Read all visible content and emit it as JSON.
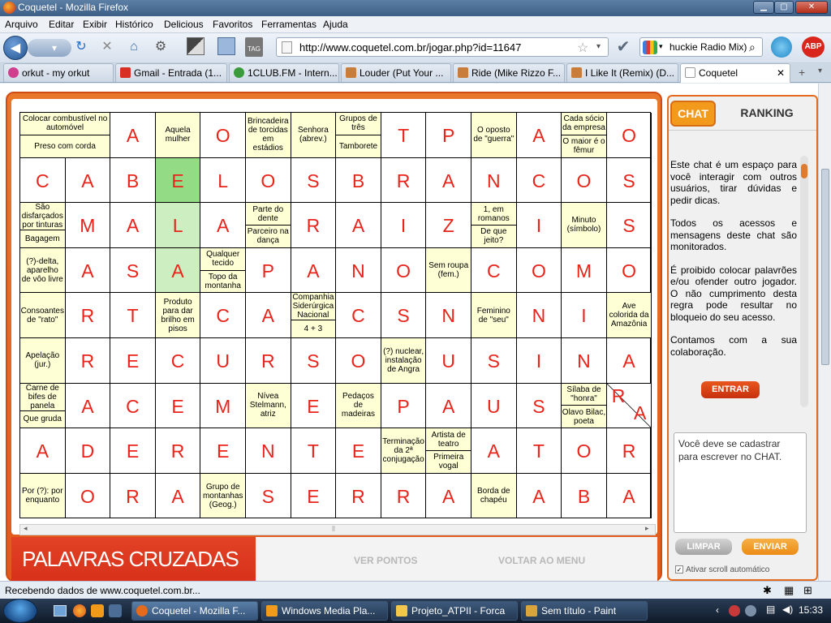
{
  "window": {
    "title": "Coquetel - Mozilla Firefox"
  },
  "menu": [
    "Arquivo",
    "Editar",
    "Exibir",
    "Histórico",
    "Delicious",
    "Favoritos",
    "Ferramentas",
    "Ajuda"
  ],
  "nav": {
    "url": "http://www.coquetel.com.br/jogar.php?id=11647",
    "search_value": "huckie Radio Mix)"
  },
  "tabs": [
    {
      "label": "orkut - my orkut",
      "color": "#d03f8e"
    },
    {
      "label": "Gmail - Entrada (1...",
      "color": "#d93025"
    },
    {
      "label": "1CLUB.FM - Intern...",
      "color": "#3a9b3a"
    },
    {
      "label": "Louder (Put Your ...",
      "color": "#c97d3b"
    },
    {
      "label": "Ride (Mike Rizzo F...",
      "color": "#c97d3b"
    },
    {
      "label": "I Like It (Remix) (D...",
      "color": "#c97d3b"
    },
    {
      "label": "Coquetel",
      "color": "#ffffff"
    }
  ],
  "crossword": {
    "rows": [
      [
        {
          "c": "Colocar combustível no automóvel|Preso com corda",
          "w": 2
        },
        {
          "l": "A"
        },
        {
          "c": "Aquela mulher"
        },
        {
          "l": "O"
        },
        {
          "c": "Brincadeira de torcidas em estádios"
        },
        {
          "c": "Senhora (abrev.)"
        },
        {
          "c": "Grupos de três|Tamborete"
        },
        {
          "l": "T"
        },
        {
          "l": "P"
        },
        {
          "c": "O oposto de \"guerra\""
        },
        {
          "l": "A"
        },
        {
          "c": "Cada sócio da empresa|O maior é o fêmur"
        },
        {
          "l": "O"
        }
      ],
      [
        {
          "l": "C"
        },
        {
          "l": "A"
        },
        {
          "l": "B"
        },
        {
          "l": "E",
          "hl": 2
        },
        {
          "l": "L"
        },
        {
          "l": "O"
        },
        {
          "l": "S"
        },
        {
          "l": "B"
        },
        {
          "l": "R"
        },
        {
          "l": "A"
        },
        {
          "l": "N"
        },
        {
          "l": "C"
        },
        {
          "l": "O"
        },
        {
          "l": "S"
        }
      ],
      [
        {
          "c": "São disfarçados por tinturas|Bagagem"
        },
        {
          "l": "M"
        },
        {
          "l": "A"
        },
        {
          "l": "L",
          "hl": 1
        },
        {
          "l": "A"
        },
        {
          "c": "Parte do dente|Parceiro na dança"
        },
        {
          "l": "R"
        },
        {
          "l": "A"
        },
        {
          "l": "I"
        },
        {
          "l": "Z"
        },
        {
          "c": "1, em romanos|De que jeito?"
        },
        {
          "l": "I"
        },
        {
          "c": "Minuto (símbolo)"
        },
        {
          "l": "S"
        }
      ],
      [
        {
          "c": "(?)-delta, aparelho de vôo livre"
        },
        {
          "l": "A"
        },
        {
          "l": "S"
        },
        {
          "l": "A",
          "hl": 1
        },
        {
          "c": "Qualquer tecido|Topo da montanha"
        },
        {
          "l": "P"
        },
        {
          "l": "A"
        },
        {
          "l": "N"
        },
        {
          "l": "O"
        },
        {
          "c": "Sem roupa (fem.)"
        },
        {
          "l": "C"
        },
        {
          "l": "O"
        },
        {
          "l": "M"
        },
        {
          "l": "O"
        }
      ],
      [
        {
          "c": "Consoantes de \"rato\""
        },
        {
          "l": "R"
        },
        {
          "l": "T"
        },
        {
          "c": "Produto para dar brilho em pisos"
        },
        {
          "l": "C"
        },
        {
          "l": "A"
        },
        {
          "c": "Companhia Siderúrgica Nacional|4 + 3"
        },
        {
          "l": "C"
        },
        {
          "l": "S"
        },
        {
          "l": "N"
        },
        {
          "c": "Feminino de \"seu\""
        },
        {
          "l": "N"
        },
        {
          "l": "I"
        },
        {
          "c": "Ave colorida da Amazônia"
        }
      ],
      [
        {
          "c": "Apelação (jur.)"
        },
        {
          "l": "R"
        },
        {
          "l": "E"
        },
        {
          "l": "C"
        },
        {
          "l": "U"
        },
        {
          "l": "R"
        },
        {
          "l": "S"
        },
        {
          "l": "O"
        },
        {
          "c": "(?) nuclear, instalação de Angra"
        },
        {
          "l": "U"
        },
        {
          "l": "S"
        },
        {
          "l": "I"
        },
        {
          "l": "N"
        },
        {
          "l": "A"
        }
      ],
      [
        {
          "c": "Carne de bifes de panela|Que gruda"
        },
        {
          "l": "A"
        },
        {
          "l": "C"
        },
        {
          "l": "E"
        },
        {
          "l": "M"
        },
        {
          "c": "Nívea Stelmann, atriz"
        },
        {
          "l": "E"
        },
        {
          "c": "Pedaços de madeiras"
        },
        {
          "l": "P"
        },
        {
          "l": "A"
        },
        {
          "l": "U"
        },
        {
          "l": "S"
        },
        {
          "c": "Sílaba de \"honra\"|Olavo Bilac, poeta"
        },
        {
          "l": "R/A"
        }
      ],
      [
        {
          "l": "A"
        },
        {
          "l": "D"
        },
        {
          "l": "E"
        },
        {
          "l": "R"
        },
        {
          "l": "E"
        },
        {
          "l": "N"
        },
        {
          "l": "T"
        },
        {
          "l": "E"
        },
        {
          "c": "Terminação da 2ª conjugação"
        },
        {
          "c": "Artista de teatro|Primeira vogal"
        },
        {
          "l": "A"
        },
        {
          "l": "T"
        },
        {
          "l": "O"
        },
        {
          "l": "R"
        }
      ],
      [
        {
          "c": "Por (?): por enquanto"
        },
        {
          "l": "O"
        },
        {
          "l": "R"
        },
        {
          "l": "A"
        },
        {
          "c": "Grupo de montanhas (Geog.)"
        },
        {
          "l": "S"
        },
        {
          "l": "E"
        },
        {
          "l": "R"
        },
        {
          "l": "R"
        },
        {
          "l": "A"
        },
        {
          "c": "Borda de chapéu"
        },
        {
          "l": "A"
        },
        {
          "l": "B"
        },
        {
          "l": "A"
        }
      ]
    ]
  },
  "game": {
    "logo": "PALAVRAS CRUZADAS",
    "ver_pontos": "VER PONTOS",
    "voltar": "VOLTAR AO MENU"
  },
  "chat": {
    "tab_chat": "CHAT",
    "tab_ranking": "RANKING",
    "p1": "Este chat é um espaço para você interagir com outros usuários, tirar dúvidas e pedir dicas.",
    "p2": "Todos os acessos e mensagens deste chat são monitorados.",
    "p3": "É proibido colocar palavrões e/ou ofender outro jogador. O não cumprimento desta regra pode resultar no bloqueio do seu acesso.",
    "p4": "Contamos com a sua colaboração.",
    "entrar": "ENTRAR",
    "message_placeholder": "Você deve se cadastrar para escrever no CHAT.",
    "limpar": "LIMPAR",
    "enviar": "ENVIAR",
    "autoscroll": "Ativar scroll automático"
  },
  "status": "Recebendo dados de www.coquetel.com.br...",
  "taskbar": [
    {
      "label": "Coquetel - Mozilla F...",
      "color": "#e46a1c"
    },
    {
      "label": "Windows Media Pla...",
      "color": "#f29b1a"
    },
    {
      "label": "Projeto_ATPII - Forca",
      "color": "#f2c84a"
    },
    {
      "label": "Sem título - Paint",
      "color": "#d9a53a"
    }
  ],
  "clock": "15:33"
}
